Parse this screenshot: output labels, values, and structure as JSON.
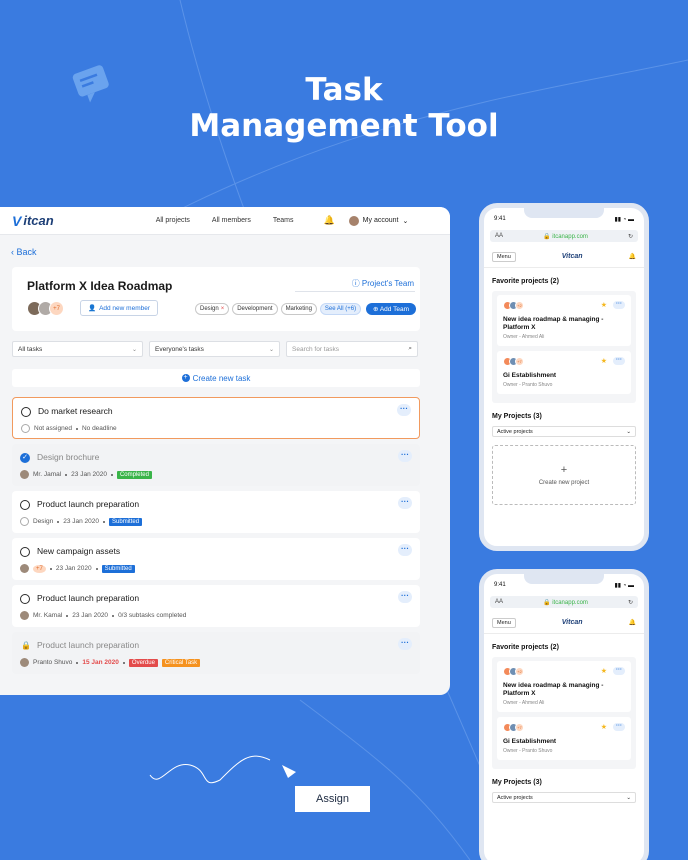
{
  "hero": {
    "line1": "Task",
    "line2": "Management Tool"
  },
  "topbar": {
    "logo": "itcan",
    "nav": [
      "All projects",
      "All members",
      "Teams"
    ],
    "account": "My account"
  },
  "back": "Back",
  "project": {
    "title": "Platform X Idea Roadmap",
    "team_link": "Project's Team",
    "more_members": "+7",
    "add_member": "Add new member",
    "tags": [
      "Design",
      "Development",
      "Marketing"
    ],
    "see_all": "See All (+6)",
    "add_team": "Add Team"
  },
  "filters": {
    "all_tasks": "All tasks",
    "everyones": "Everyone's tasks",
    "search_placeholder": "Search for tasks"
  },
  "create_task": "Create new task",
  "tasks": [
    {
      "title": "Do market research",
      "assignee": "Not assigned",
      "due": "No deadline"
    },
    {
      "title": "Design brochure",
      "assignee": "Mr. Jamal",
      "due": "23 Jan 2020",
      "badge": "Completed"
    },
    {
      "title": "Product launch preparation",
      "assignee": "Design",
      "due": "23 Jan 2020",
      "badge": "Submitted"
    },
    {
      "title": "New campaign assets",
      "assignee": "+7",
      "due": "23 Jan 2020",
      "badge": "Submitted"
    },
    {
      "title": "Product launch preparation",
      "assignee": "Mr. Kamal",
      "due": "23 Jan 2020",
      "subtasks": "0/3 subtasks completed"
    },
    {
      "title": "Product launch preparation",
      "assignee": "Pranto Shuvo",
      "due": "15 Jan 2020",
      "badge": "Overdue",
      "badge2": "Critical Task"
    }
  ],
  "phone": {
    "time": "9:41",
    "aa": "AA",
    "url": "itcanapp.com",
    "menu": "Menu",
    "logo": "itcan",
    "favorites_title": "Favorite projects (2)",
    "favorites": [
      {
        "name": "New idea roadmap & managing - Platform X",
        "owner": "Owner - Ahmed Ali",
        "more": "+2"
      },
      {
        "name": "Gi Establishment",
        "owner": "Owner - Pranto Shuvo",
        "more": "+7"
      }
    ],
    "my_projects_title": "My Projects (3)",
    "active_select": "Active projects",
    "create_project": "Create new project"
  },
  "assign": "Assign",
  "colors": {
    "background": "#3a7be0",
    "accent": "#1d6fd8",
    "completed": "#3ab449",
    "overdue": "#e34b4b",
    "critical": "#f5921f"
  }
}
